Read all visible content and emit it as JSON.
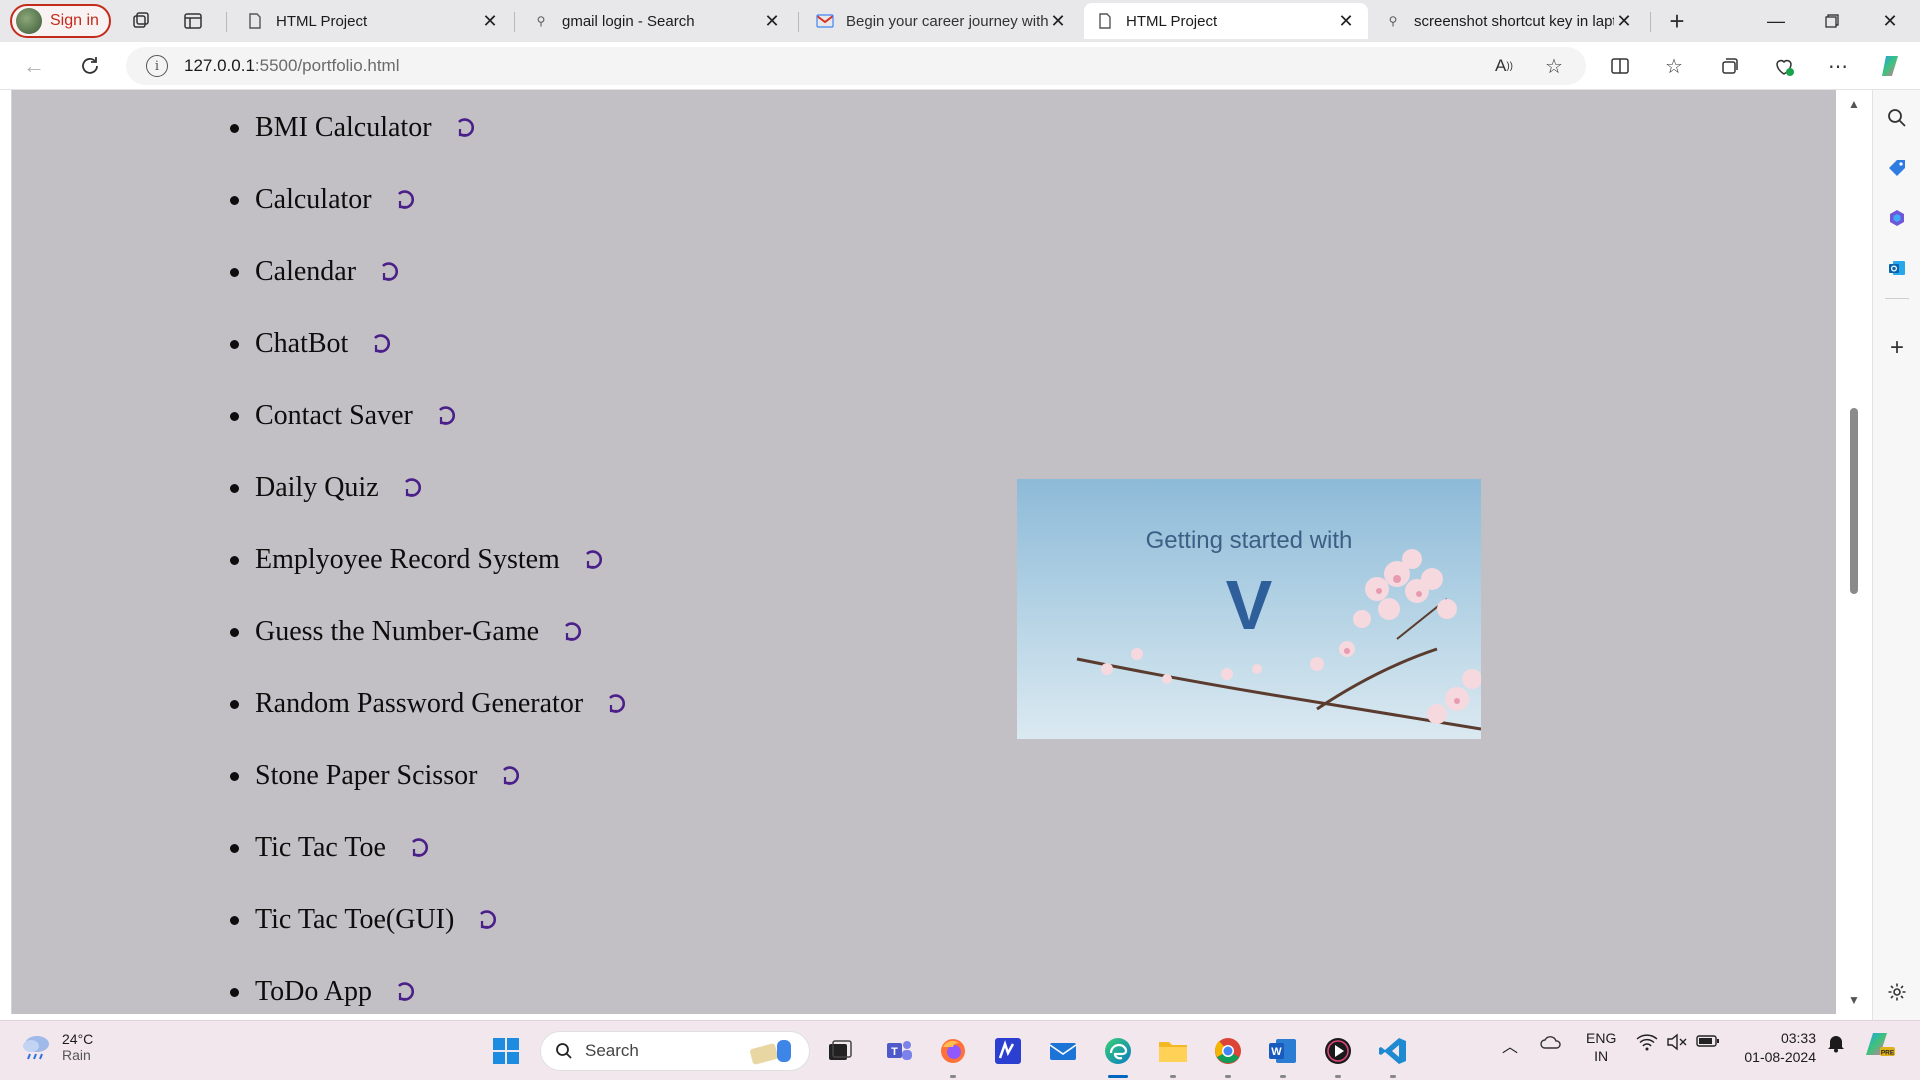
{
  "browser": {
    "signin_label": "Sign in",
    "tabs": [
      {
        "title": "HTML Project",
        "favicon": "page-icon",
        "active": false
      },
      {
        "title": "gmail login - Search",
        "favicon": "search-icon",
        "active": false
      },
      {
        "title": "Begin your career journey with",
        "favicon": "gmail-icon",
        "active": false
      },
      {
        "title": "HTML Project",
        "favicon": "page-icon",
        "active": true
      },
      {
        "title": "screenshot shortcut key in lapt",
        "favicon": "search-icon",
        "active": false
      }
    ],
    "url_host": "127.0.0.1",
    "url_rest": ":5500/portfolio.html"
  },
  "page": {
    "projects": [
      "BMI Calculator",
      "Calculator",
      "Calendar",
      "ChatBot",
      "Contact Saver",
      "Daily Quiz",
      "Emplyoyee Record System",
      "Guess the Number-Game",
      "Random Password Generator",
      "Stone Paper Scissor",
      "Tic Tac Toe",
      "Tic Tac Toe(GUI)",
      "ToDo App"
    ],
    "image_caption": "Getting started with",
    "image_logo": "V",
    "arrow_color": "#4b1f8a",
    "background_color": "#c2c0c4"
  },
  "taskbar": {
    "weather_temp": "24°C",
    "weather_desc": "Rain",
    "search_placeholder": "Search",
    "lang_1": "ENG",
    "lang_2": "IN",
    "time": "03:33",
    "date": "01-08-2024"
  }
}
